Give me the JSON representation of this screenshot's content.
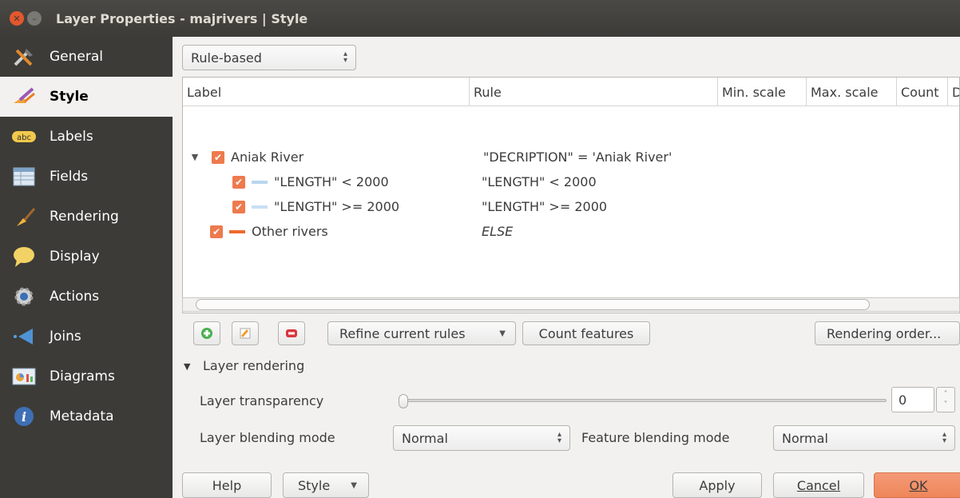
{
  "window": {
    "title": "Layer Properties - majrivers | Style"
  },
  "sidebar": {
    "items": [
      {
        "label": "General",
        "icon": "tools-icon"
      },
      {
        "label": "Style",
        "icon": "paintbrush-icon"
      },
      {
        "label": "Labels",
        "icon": "abc-icon"
      },
      {
        "label": "Fields",
        "icon": "table-icon"
      },
      {
        "label": "Rendering",
        "icon": "brush-icon"
      },
      {
        "label": "Display",
        "icon": "speech-bubble-icon"
      },
      {
        "label": "Actions",
        "icon": "gear-icon"
      },
      {
        "label": "Joins",
        "icon": "join-arrow-icon"
      },
      {
        "label": "Diagrams",
        "icon": "chart-icon"
      },
      {
        "label": "Metadata",
        "icon": "info-icon"
      }
    ]
  },
  "renderer": {
    "selected": "Rule-based"
  },
  "tree": {
    "columns": [
      "Label",
      "Rule",
      "Min. scale",
      "Max. scale",
      "Count",
      "D"
    ],
    "rows": [
      {
        "label": "Aniak River",
        "rule": "\"DECRIPTION\" = 'Aniak River'",
        "color": ""
      },
      {
        "label": "\"LENGTH\" < 2000",
        "rule": "\"LENGTH\" < 2000",
        "color": "#b9d6ef"
      },
      {
        "label": "\"LENGTH\" >= 2000",
        "rule": "\"LENGTH\" >= 2000",
        "color": "#c8def3"
      },
      {
        "label": "Other rivers",
        "rule": "ELSE",
        "color": "#ee6a2a"
      }
    ]
  },
  "toolbar": {
    "refine_label": "Refine current rules",
    "count_label": "Count features",
    "order_label": "Rendering order..."
  },
  "layer_rendering": {
    "section_label": "Layer rendering",
    "transparency_label": "Layer transparency",
    "transparency_value": "0",
    "transparency_level": 0,
    "blend_label": "Layer blending mode",
    "blend_value": "Normal",
    "feature_blend_label": "Feature blending mode",
    "feature_blend_value": "Normal"
  },
  "footer": {
    "help": "Help",
    "style": "Style",
    "apply": "Apply",
    "cancel": "Cancel",
    "ok": "OK"
  },
  "colors": {
    "accent": "#ee7a4d",
    "sidebar": "#3c3b37",
    "titlebar": "#3c3b37"
  }
}
